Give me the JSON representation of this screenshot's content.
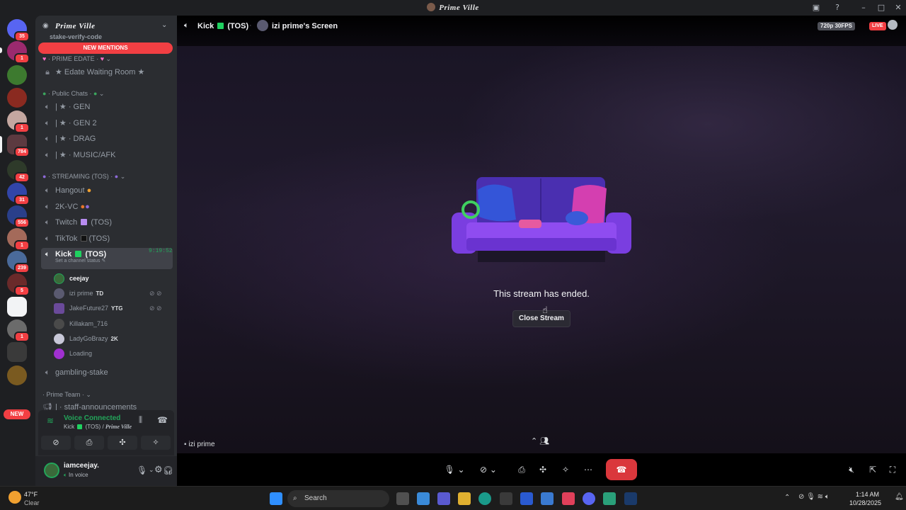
{
  "window": {
    "title": "Prime Ville",
    "controls": [
      "screen-share-icon",
      "help-icon",
      "minimize-icon",
      "maximize-icon",
      "close-icon"
    ]
  },
  "rail": {
    "badges": [
      "35",
      "1",
      "1",
      "784",
      "42",
      "31",
      "556",
      "1",
      "239",
      "5",
      "1"
    ],
    "new_label": "NEW"
  },
  "sidebar": {
    "guild_name": "Prime Ville",
    "partial_top_channel": "stake-verify-code",
    "new_mentions": "NEW MENTIONS",
    "categories": {
      "edate": "PRIME EDATE",
      "public": "Public Chats",
      "streaming": "STREAMING (TOS)",
      "team": "Prime Team"
    },
    "channels": {
      "edate_room": "★ Edate Waiting Room ★",
      "gen": "| ★ · GEN",
      "gen2": "| ★ · GEN 2",
      "drag": "| ★ · DRAG",
      "music": "| ★ · MUSIC/AFK",
      "hangout": "Hangout",
      "twok": "2K-VC",
      "twitch": "Twitch",
      "twitch_suffix": "(TOS)",
      "tiktok": "TikTok",
      "tiktok_suffix": "(TOS)",
      "kick": "Kick",
      "kick_suffix": "(TOS)",
      "kick_timer": "9:19:52",
      "kick_status": "Set a channel status",
      "gambling": "gambling-stake",
      "staff": "| · staff-announcements"
    },
    "members": [
      {
        "name": "ceejay",
        "tag": ""
      },
      {
        "name": "izi prime",
        "tag": "TD"
      },
      {
        "name": "JakeFuture27",
        "tag": "YTG"
      },
      {
        "name": "Killakam_716",
        "tag": ""
      },
      {
        "name": "LadyGoBrazy",
        "tag": "2K"
      },
      {
        "name": "Loading",
        "tag": ""
      }
    ]
  },
  "voice": {
    "status": "Voice Connected",
    "channel": "Kick",
    "channel_suffix": "(TOS) /",
    "server": "Prime Ville"
  },
  "user": {
    "name": "iamceejay.",
    "status": "In voice"
  },
  "stream": {
    "channel": "Kick",
    "channel_suffix": "(TOS)",
    "screen_title": "izi prime's Screen",
    "quality": "720p 30FPS",
    "live": "LIVE",
    "ended_message": "This stream has ended.",
    "close_button": "Close Stream",
    "streamer_label": "izi prime"
  },
  "colors": {
    "accent_green": "#23a55a",
    "danger_red": "#da373c",
    "kick_green": "#1fd160",
    "twitch_purple": "#a970ff"
  },
  "taskbar": {
    "weather_temp": "47°F",
    "weather_desc": "Clear",
    "search_placeholder": "Search",
    "time": "1:14 AM",
    "date": "10/28/2025"
  }
}
